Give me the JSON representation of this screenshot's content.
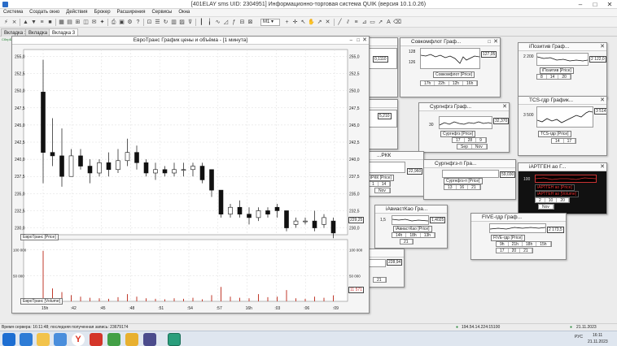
{
  "window": {
    "title": "[401ELAY sms UID: 2304951] Информационно-торговая система QUIK (версия 10.1.0.26)"
  },
  "menu": [
    "Система",
    "Создать окно",
    "Действия",
    "Брокер",
    "Расширения",
    "Сервисы",
    "Окна"
  ],
  "toolbar": {
    "timeframe": "M1"
  },
  "tabs": [
    "Вкладка 1",
    "Вкладка 2",
    "Вкладка 3"
  ],
  "broker": {
    "name": "СберБанк",
    "note": "Облигационные обязательства QUIK"
  },
  "main_chart": {
    "title": "ЕвроТранс График цены и объёма - [1 минута]",
    "price_axis": [
      "255,0",
      "252,5",
      "250,0",
      "247,5",
      "245,0",
      "242,5",
      "240,0",
      "237,5",
      "235,0",
      "232,5",
      "230,0"
    ],
    "price_legend": "ЕвроТранс [Price]",
    "last_price": "229,25",
    "volume_axis": [
      "100 000",
      "50 000"
    ],
    "volume_legend": "ЕвроТранс [Volume]",
    "last_volume": "11 571",
    "time_ticks": [
      "15h",
      ":42",
      ":45",
      ":48",
      ":51",
      ":54",
      ":57",
      "16h",
      ":03",
      ":06",
      ":09"
    ]
  },
  "chart_data": {
    "type": "candlestick",
    "title": "ЕвроТранс График цены и объёма - [1 минута]",
    "ylim": [
      229,
      256
    ],
    "candles": [
      {
        "o": 249.8,
        "h": 254.5,
        "l": 236.5,
        "c": 241.0
      },
      {
        "o": 241.0,
        "h": 246.0,
        "l": 239.0,
        "c": 240.5
      },
      {
        "o": 240.5,
        "h": 244.5,
        "l": 236.0,
        "c": 237.5
      },
      {
        "o": 237.5,
        "h": 241.5,
        "l": 237.5,
        "c": 240.5
      },
      {
        "o": 240.5,
        "h": 241.5,
        "l": 238.5,
        "c": 239.0
      },
      {
        "o": 239.0,
        "h": 240.0,
        "l": 236.5,
        "c": 238.0
      },
      {
        "o": 238.0,
        "h": 240.0,
        "l": 237.5,
        "c": 239.5
      },
      {
        "o": 239.5,
        "h": 241.0,
        "l": 237.5,
        "c": 238.5
      },
      {
        "o": 238.5,
        "h": 241.5,
        "l": 238.0,
        "c": 239.8
      },
      {
        "o": 239.8,
        "h": 243.0,
        "l": 239.0,
        "c": 241.0
      },
      {
        "o": 241.0,
        "h": 242.0,
        "l": 238.5,
        "c": 239.5
      },
      {
        "o": 239.5,
        "h": 240.0,
        "l": 237.5,
        "c": 238.0
      },
      {
        "o": 238.0,
        "h": 239.5,
        "l": 237.0,
        "c": 238.5
      },
      {
        "o": 238.5,
        "h": 239.0,
        "l": 237.5,
        "c": 238.0
      },
      {
        "o": 238.0,
        "h": 239.5,
        "l": 237.5,
        "c": 238.5
      },
      {
        "o": 238.5,
        "h": 239.5,
        "l": 237.5,
        "c": 238.5
      },
      {
        "o": 238.5,
        "h": 239.5,
        "l": 237.5,
        "c": 239.0
      },
      {
        "o": 239.0,
        "h": 239.5,
        "l": 236.5,
        "c": 237.0
      },
      {
        "o": 238.5,
        "h": 238.5,
        "l": 234.5,
        "c": 235.5
      },
      {
        "o": 235.5,
        "h": 235.5,
        "l": 231.5,
        "c": 232.0
      },
      {
        "o": 232.0,
        "h": 233.5,
        "l": 231.5,
        "c": 233.0
      },
      {
        "o": 233.0,
        "h": 234.0,
        "l": 231.5,
        "c": 232.0
      },
      {
        "o": 232.0,
        "h": 233.0,
        "l": 230.5,
        "c": 231.5
      },
      {
        "o": 231.5,
        "h": 233.0,
        "l": 231.0,
        "c": 232.5
      },
      {
        "o": 232.5,
        "h": 233.0,
        "l": 231.5,
        "c": 232.0
      },
      {
        "o": 233.0,
        "h": 233.5,
        "l": 231.5,
        "c": 232.5
      },
      {
        "o": 232.5,
        "h": 232.5,
        "l": 229.5,
        "c": 230.0
      },
      {
        "o": 230.5,
        "h": 231.5,
        "l": 230.0,
        "c": 231.0
      },
      {
        "o": 231.0,
        "h": 231.5,
        "l": 230.5,
        "c": 231.0
      },
      {
        "o": 231.0,
        "h": 232.5,
        "l": 229.5,
        "c": 230.0
      },
      {
        "o": 230.5,
        "h": 232.0,
        "l": 230.0,
        "c": 231.5
      },
      {
        "o": 231.0,
        "h": 231.5,
        "l": 228.5,
        "c": 229.25
      }
    ],
    "volumes": [
      98000,
      25000,
      18000,
      12000,
      9000,
      7000,
      6000,
      5000,
      8000,
      14000,
      9000,
      6000,
      5000,
      4000,
      6000,
      5000,
      7000,
      4000,
      12000,
      28000,
      9000,
      7000,
      6000,
      14000,
      8000,
      9000,
      22000,
      6000,
      5000,
      9000,
      7000,
      11571
    ]
  },
  "mini_charts": [
    {
      "title": "Совкомфлот Граф...",
      "axis": [
        "128",
        "126"
      ],
      "price": "127,05",
      "legend": "Совкомфлот [Price]",
      "ticks": [
        "17h",
        "22h",
        "12h",
        "16h"
      ]
    },
    {
      "title": "iПозитив Граф...",
      "axis": [
        "2 200"
      ],
      "price": "2 122,0",
      "legend": "iПозитив [Price]",
      "ticks": [
        "8",
        "14",
        "20"
      ]
    },
    {
      "title": "Сургнфгз Граф...",
      "axis": [
        "30"
      ],
      "price": "32,370",
      "legend": "Сургнфгз [Price]",
      "ticks": [
        "17",
        "28",
        "9"
      ],
      "ticks2": [
        "Sep",
        "Nov"
      ]
    },
    {
      "title": "TCS-гдр График...",
      "axis": [
        "3 500"
      ],
      "price": "3 514",
      "legend": "TCS-гдр [Price]",
      "ticks": [
        "14",
        "17"
      ]
    },
    {
      "title": "Сургнфгз-п Гра...",
      "axis": [],
      "price": "59,030",
      "legend": "Сургнфгз-п [Price]",
      "ticks": [
        "13",
        "16",
        "21"
      ]
    },
    {
      "title": "iАРТГЕН ао Г...",
      "axis": [
        "100"
      ],
      "price": "",
      "legend": "iАРТГЕН ао [Price]",
      "legend2": "iАРТГЕН ао [Volume]",
      "ticks": [
        "2",
        "10",
        "20"
      ],
      "ticks2": [
        "Nov"
      ]
    },
    {
      "title": "iАвиастКао Гра...",
      "axis": [
        "1,5"
      ],
      "price": "1,4025",
      "legend": "iАвиастКао [Price]",
      "ticks": [
        "14h",
        "18h",
        "13h"
      ],
      "ticks2": [
        "21"
      ]
    },
    {
      "title": "FIVE-гдр Граф...",
      "axis": [],
      "price": "2 173,5",
      "legend": "FIVE-гдр [Price]",
      "ticks": [
        "9h",
        "21h",
        "18h",
        "15h"
      ],
      "ticks2": [
        "17",
        "20",
        "21"
      ]
    },
    {
      "title": "",
      "axis": [],
      "price": "0,1110",
      "legend": "",
      "ticks": []
    },
    {
      "title": "",
      "axis": [],
      "price": "5,210",
      "legend": "",
      "ticks": []
    },
    {
      "title": "...РКК",
      "axis": [],
      "price": "22,960",
      "legend": "iРКК [Price]",
      "ticks": [
        "1",
        "14"
      ],
      "ticks2": [
        "Nov"
      ]
    },
    {
      "title": "",
      "axis": [],
      "price": "228,94",
      "legend": "",
      "ticks": [
        "21"
      ]
    }
  ],
  "status": {
    "server_time": "Время сервера: 16:11:48; последняя полученная запись: 23679174",
    "connection": "194.54.14.224:15100",
    "date": "21.11.2023"
  },
  "taskbar": {
    "lang": "РУС",
    "time": "16:11",
    "date": "21.11.2023"
  }
}
